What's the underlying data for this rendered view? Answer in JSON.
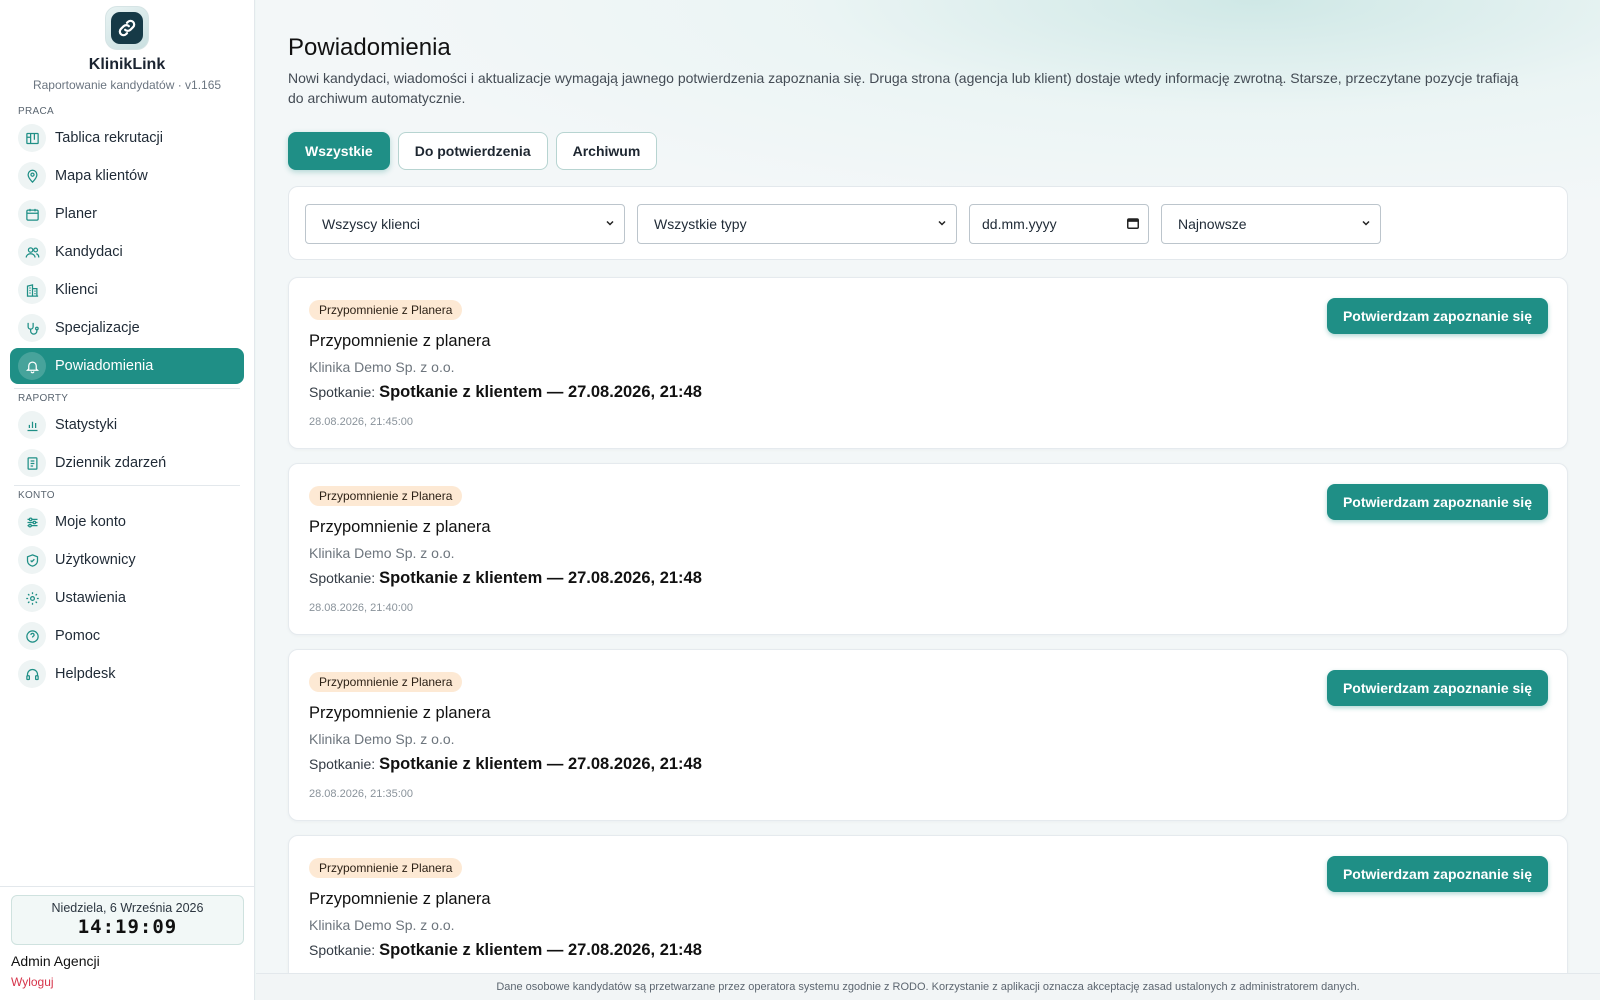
{
  "sidebar": {
    "brand": {
      "name": "KlinikLink",
      "subtitle": "Raportowanie kandydatów · v1.165",
      "logo_icon": "link-icon"
    },
    "sections": [
      {
        "label": "PRACA",
        "items": [
          {
            "label": "Tablica rekrutacji",
            "icon": "board-icon"
          },
          {
            "label": "Mapa klientów",
            "icon": "map-pin-icon"
          },
          {
            "label": "Planer",
            "icon": "calendar-icon"
          },
          {
            "label": "Kandydaci",
            "icon": "users-icon"
          },
          {
            "label": "Klienci",
            "icon": "building-icon"
          },
          {
            "label": "Specjalizacje",
            "icon": "stethoscope-icon"
          },
          {
            "label": "Powiadomienia",
            "icon": "bell-icon",
            "active": true
          }
        ]
      },
      {
        "label": "RAPORTY",
        "items": [
          {
            "label": "Statystyki",
            "icon": "bar-chart-icon"
          },
          {
            "label": "Dziennik zdarzeń",
            "icon": "log-icon"
          }
        ]
      },
      {
        "label": "KONTO",
        "items": [
          {
            "label": "Moje konto",
            "icon": "sliders-icon"
          },
          {
            "label": "Użytkownicy",
            "icon": "shield-icon"
          },
          {
            "label": "Ustawienia",
            "icon": "gear-icon"
          },
          {
            "label": "Pomoc",
            "icon": "help-icon"
          },
          {
            "label": "Helpdesk",
            "icon": "headset-icon"
          }
        ]
      }
    ],
    "footer": {
      "date": "Niedziela, 6 Września 2026",
      "time": "14:19:09",
      "user": "Admin Agencji",
      "logout": "Wyloguj"
    }
  },
  "main": {
    "title": "Powiadomienia",
    "description": "Nowi kandydaci, wiadomości i aktualizacje wymagają jawnego potwierdzenia zapoznania się. Druga strona (agencja lub klient) dostaje wtedy informację zwrotną. Starsze, przeczytane pozycje trafiają do archiwum automatycznie.",
    "tabs": [
      {
        "label": "Wszystkie",
        "active": true
      },
      {
        "label": "Do potwierdzenia",
        "active": false
      },
      {
        "label": "Archiwum",
        "active": false
      }
    ],
    "filters": {
      "client": "Wszyscy klienci",
      "type": "Wszystkie typy",
      "date_placeholder": "dd.mm.yyyy",
      "sort": "Najnowsze"
    },
    "notifications": [
      {
        "badge": "Przypomnienie z Planera",
        "title": "Przypomnienie z planera",
        "client": "Klinika Demo Sp. z o.o.",
        "meeting_label": "Spotkanie:",
        "meeting": "Spotkanie z klientem — 27.08.2026, 21:48",
        "timestamp": "28.08.2026, 21:45:00",
        "action": "Potwierdzam zapoznanie się"
      },
      {
        "badge": "Przypomnienie z Planera",
        "title": "Przypomnienie z planera",
        "client": "Klinika Demo Sp. z o.o.",
        "meeting_label": "Spotkanie:",
        "meeting": "Spotkanie z klientem — 27.08.2026, 21:48",
        "timestamp": "28.08.2026, 21:40:00",
        "action": "Potwierdzam zapoznanie się"
      },
      {
        "badge": "Przypomnienie z Planera",
        "title": "Przypomnienie z planera",
        "client": "Klinika Demo Sp. z o.o.",
        "meeting_label": "Spotkanie:",
        "meeting": "Spotkanie z klientem — 27.08.2026, 21:48",
        "timestamp": "28.08.2026, 21:35:00",
        "action": "Potwierdzam zapoznanie się"
      },
      {
        "badge": "Przypomnienie z Planera",
        "title": "Przypomnienie z planera",
        "client": "Klinika Demo Sp. z o.o.",
        "meeting_label": "Spotkanie:",
        "meeting": "Spotkanie z klientem — 27.08.2026, 21:48",
        "timestamp": "",
        "action": "Potwierdzam zapoznanie się"
      }
    ],
    "footer_note": "Dane osobowe kandydatów są przetwarzane przez operatora systemu zgodnie z RODO. Korzystanie z aplikacji oznacza akceptację zasad ustalonych z administratorem danych."
  },
  "colors": {
    "accent": "#1f8f86",
    "badge_bg": "#fde9d4",
    "logout": "#d6344a"
  }
}
